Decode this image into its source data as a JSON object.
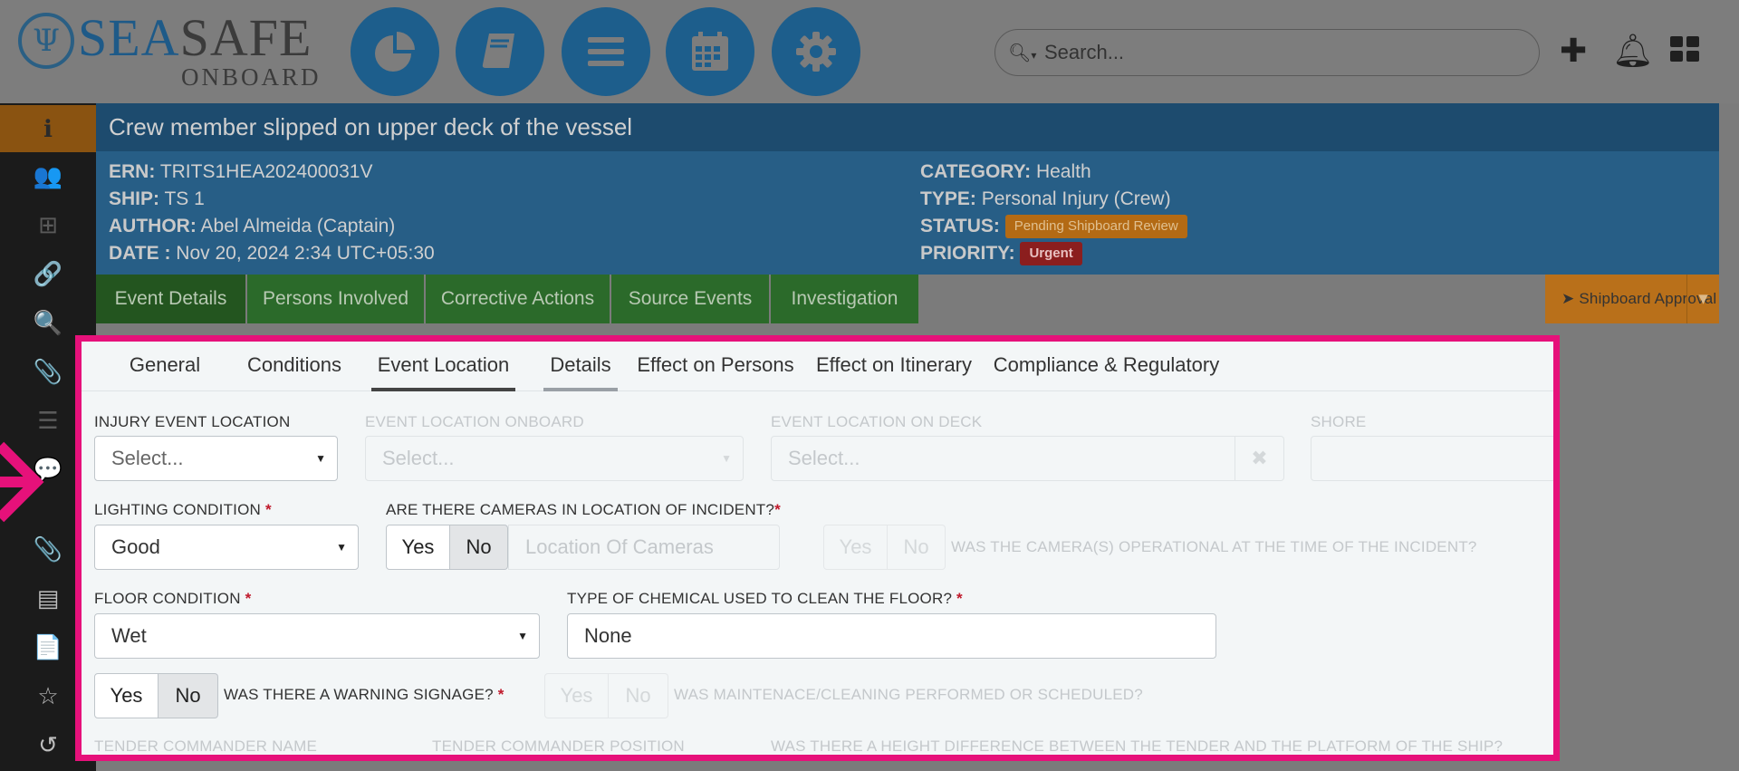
{
  "brand": {
    "sea": "SEA",
    "safe": "SAFE",
    "sub": "ONBOARD"
  },
  "nav": [
    {
      "icon": "pie-chart-icon"
    },
    {
      "icon": "book-icon"
    },
    {
      "icon": "menu-icon"
    },
    {
      "icon": "calendar-icon"
    },
    {
      "icon": "gear-icon"
    }
  ],
  "search": {
    "placeholder": "Search..."
  },
  "sidebar": [
    {
      "icon": "info-icon",
      "glyph": "ℹ",
      "active": true
    },
    {
      "icon": "users-icon",
      "glyph": "👥"
    },
    {
      "icon": "sitemap-icon",
      "glyph": "⊞"
    },
    {
      "icon": "link-icon",
      "glyph": "🔗"
    },
    {
      "icon": "search-icon",
      "glyph": "🔍"
    },
    {
      "icon": "paperclip-icon",
      "glyph": "📎"
    },
    {
      "icon": "list-icon",
      "glyph": "☰"
    },
    {
      "icon": "comments-icon",
      "glyph": "💬"
    },
    {
      "icon": "attachment-icon",
      "glyph": "📎"
    },
    {
      "icon": "storage-icon",
      "glyph": "▤"
    },
    {
      "icon": "document-icon",
      "glyph": "📄"
    },
    {
      "icon": "star-icon",
      "glyph": "☆"
    },
    {
      "icon": "history-icon",
      "glyph": "↺"
    }
  ],
  "event": {
    "title": "Crew member slipped on upper deck of the vessel",
    "ern_label": "ERN:",
    "ern": "TRITS1HEA202400031V",
    "ship_label": "SHIP:",
    "ship": "TS 1",
    "author_label": "AUTHOR:",
    "author": "Abel Almeida (Captain)",
    "date_label": "DATE :",
    "date": "Nov 20, 2024 2:34 UTC+05:30",
    "category_label": "CATEGORY:",
    "category": "Health",
    "type_label": "TYPE:",
    "type": "Personal Injury (Crew)",
    "status_label": "STATUS:",
    "status": "Pending Shipboard Review",
    "priority_label": "PRIORITY:",
    "priority": "Urgent"
  },
  "main_tabs": [
    "Event Details",
    "Persons Involved",
    "Corrective Actions",
    "Source Events",
    "Investigation"
  ],
  "approve_label": "Shipboard Approval",
  "sub_tabs": [
    "General",
    "Conditions",
    "Event Location",
    "Details",
    "Effect on Persons",
    "Effect on Itinerary",
    "Compliance & Regulatory"
  ],
  "form": {
    "injury_location_label": "INJURY EVENT LOCATION",
    "injury_location_value": "Select...",
    "onboard_label": "EVENT LOCATION ONBOARD",
    "onboard_value": "Select...",
    "deck_label": "EVENT LOCATION ON DECK",
    "deck_value": "Select...",
    "shore_label": "SHORE",
    "lighting_label": "LIGHTING CONDITION",
    "lighting_value": "Good",
    "cameras_label": "ARE THERE CAMERAS IN LOCATION OF INCIDENT?",
    "cameras_location_placeholder": "Location Of Cameras",
    "camera_operational_label": "WAS THE CAMERA(S) OPERATIONAL AT THE TIME OF THE INCIDENT?",
    "floor_label": "FLOOR CONDITION",
    "floor_value": "Wet",
    "chemical_label": "TYPE OF CHEMICAL USED TO CLEAN THE FLOOR?",
    "chemical_value": "None",
    "signage_label": "WAS THERE A WARNING SIGNAGE?",
    "maintenance_label": "WAS MAINTENACE/CLEANING PERFORMED OR SCHEDULED?",
    "tender_name_label": "TENDER COMMANDER NAME",
    "tender_position_label": "TENDER COMMANDER POSITION",
    "height_diff_label": "WAS THERE A HEIGHT DIFFERENCE BETWEEN THE TENDER AND THE PLATFORM OF THE SHIP?",
    "yes": "Yes",
    "no": "No",
    "required_mark": "*"
  }
}
